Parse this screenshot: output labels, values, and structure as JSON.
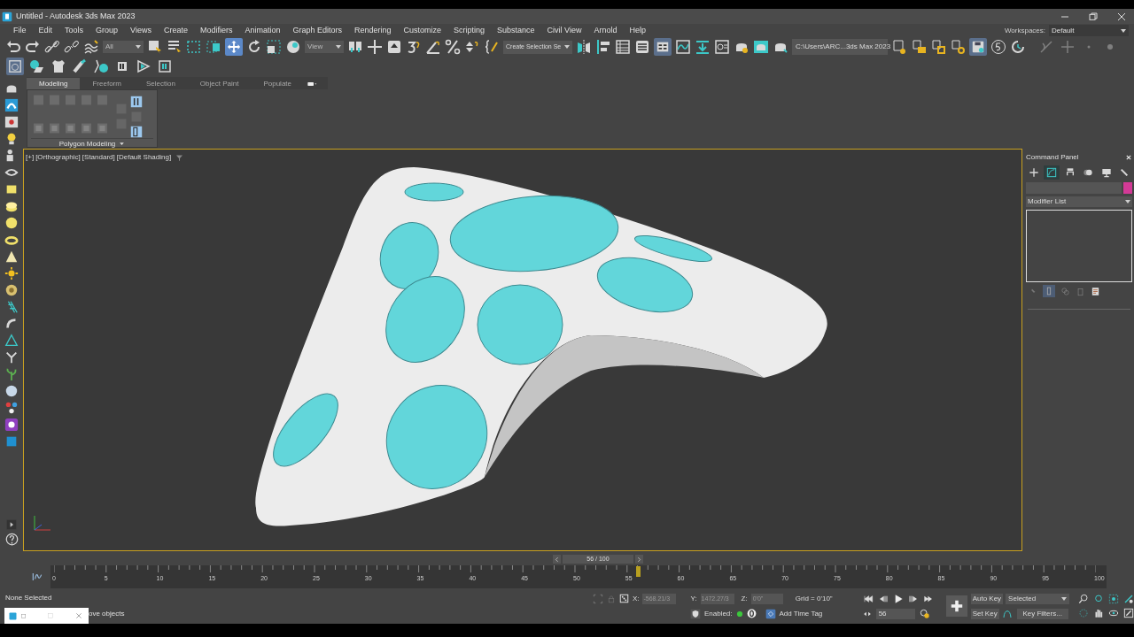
{
  "window": {
    "title": "Untitled - Autodesk 3ds Max 2023"
  },
  "menu": [
    "File",
    "Edit",
    "Tools",
    "Group",
    "Views",
    "Create",
    "Modifiers",
    "Animation",
    "Graph Editors",
    "Rendering",
    "Customize",
    "Scripting",
    "Substance",
    "Civil View",
    "Arnold",
    "Help"
  ],
  "workspaces": {
    "label": "Workspaces:",
    "value": "Default"
  },
  "main_toolbar": {
    "selection_filter": "All",
    "reference_coordinate": "View",
    "named_selection": "Create Selection Se",
    "project_folder": "C:\\Users\\ARC...3ds Max 2023"
  },
  "ribbon": {
    "tabs": [
      {
        "label": "Modeling",
        "selected": true
      },
      {
        "label": "Freeform",
        "selected": false
      },
      {
        "label": "Selection",
        "selected": false
      },
      {
        "label": "Object Paint",
        "selected": false
      },
      {
        "label": "Populate",
        "selected": false
      }
    ],
    "panel_title": "Polygon Modeling"
  },
  "viewport": {
    "labels": [
      "[+]",
      "[Orthographic]",
      "[Standard]",
      "[Default Shading]"
    ]
  },
  "command_panel": {
    "title": "Command Panel",
    "tabs": [
      {
        "selected": false
      },
      {
        "selected": true
      },
      {
        "selected": false
      },
      {
        "selected": false
      },
      {
        "selected": false
      },
      {
        "selected": false
      }
    ],
    "modifier_list": "Modifier List"
  },
  "time_slider": {
    "frame": "56 / 100",
    "level": 0.56,
    "ticks": [
      "0",
      "5",
      "10",
      "15",
      "20",
      "25",
      "30",
      "35",
      "40",
      "45",
      "50",
      "55",
      "60",
      "65",
      "70",
      "75",
      "80",
      "85",
      "90",
      "95",
      "100"
    ]
  },
  "status": {
    "selection": "None Selected",
    "prompt": "ove objects"
  },
  "coordinates": {
    "x_label": "X:",
    "x": "-568.21/3",
    "y_label": "Y:",
    "y": "1472.27/3",
    "z_label": "Z:",
    "z": "0'0\"",
    "grid": "Grid = 0'10\""
  },
  "time_tag": {
    "enabled_label": "Enabled:",
    "add": "Add Time Tag"
  },
  "animation": {
    "auto_key": "Auto Key",
    "set_key": "Set Key",
    "key_mode": "Selected",
    "key_filters": "Key Filters...",
    "current_frame": "56"
  }
}
